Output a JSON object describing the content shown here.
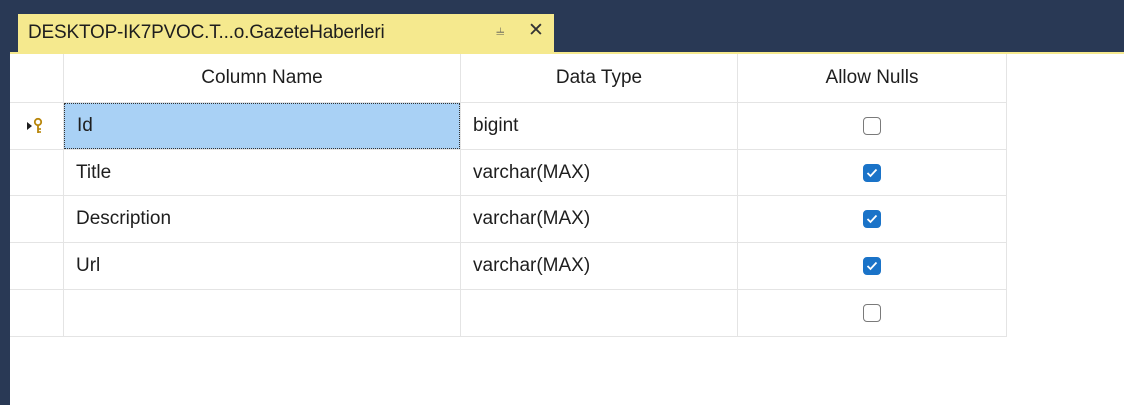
{
  "tab": {
    "title": "DESKTOP-IK7PVOC.T...o.GazeteHaberleri",
    "pin_icon": "pin-icon",
    "close_icon": "close-icon"
  },
  "columns": {
    "name": "Column Name",
    "type": "Data Type",
    "nulls": "Allow Nulls"
  },
  "rows": [
    {
      "name": "Id",
      "type": "bigint",
      "allow_nulls": false,
      "primary_key": true,
      "selected": true
    },
    {
      "name": "Title",
      "type": "varchar(MAX)",
      "allow_nulls": true
    },
    {
      "name": "Description",
      "type": "varchar(MAX)",
      "allow_nulls": true
    },
    {
      "name": "Url",
      "type": "varchar(MAX)",
      "allow_nulls": true
    },
    {
      "name": "",
      "type": "",
      "allow_nulls": false
    }
  ],
  "colors": {
    "chrome": "#293955",
    "tab": "#f5e98e",
    "selection": "#a9d1f5",
    "checkbox_checked": "#1a73c8"
  }
}
